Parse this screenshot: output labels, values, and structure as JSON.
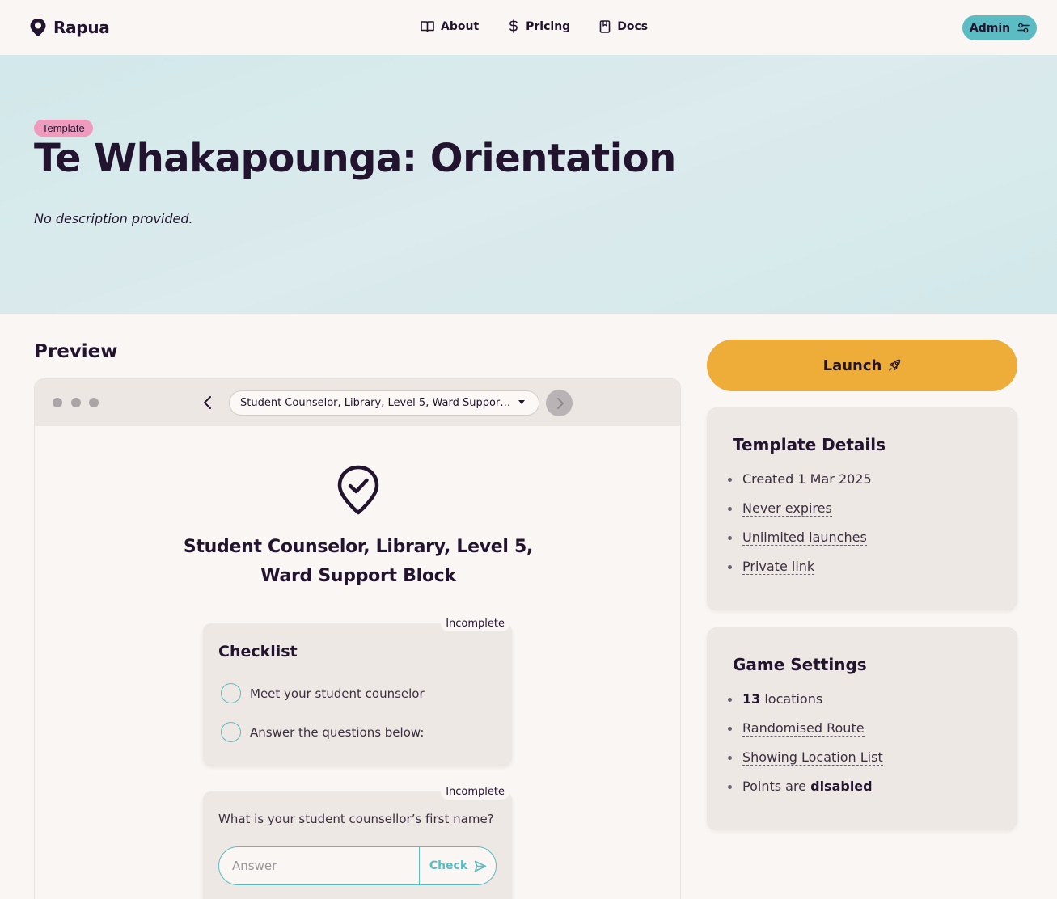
{
  "brand": {
    "name": "Rapua"
  },
  "nav": {
    "about": "About",
    "pricing": "Pricing",
    "docs": "Docs",
    "admin": "Admin"
  },
  "hero": {
    "badge": "Template",
    "title": "Te Whakapounga: Orientation",
    "description": "No description provided."
  },
  "preview": {
    "heading": "Preview",
    "location_select": "Student Counselor, Library, Level 5, Ward Support Block",
    "location_title_line1": "Student Counselor, Library, Level 5,",
    "location_title_line2": "Ward Support Block",
    "checklist": {
      "status": "Incomplete",
      "title": "Checklist",
      "items": [
        "Meet your student counselor",
        "Answer the questions below:"
      ]
    },
    "question": {
      "status": "Incomplete",
      "text": "What is your student counsellor’s first name?",
      "placeholder": "Answer",
      "check_label": "Check"
    }
  },
  "launch": {
    "label": "Launch"
  },
  "template_details": {
    "title": "Template Details",
    "created": "Created 1 Mar 2025",
    "expires": "Never expires",
    "launches": "Unlimited launches",
    "link": "Private link"
  },
  "game_settings": {
    "title": "Game Settings",
    "locations_count": "13",
    "locations_word": " locations",
    "route": "Randomised Route",
    "location_list": "Showing Location List",
    "points_prefix": "Points are ",
    "points_state": "disabled"
  },
  "colors": {
    "accent_teal": "#5bbcc4",
    "launch_orange": "#edad38",
    "badge_pink": "#ee9bbd",
    "text_dark": "#22132e",
    "hero_bg": "#d2e8ea"
  }
}
